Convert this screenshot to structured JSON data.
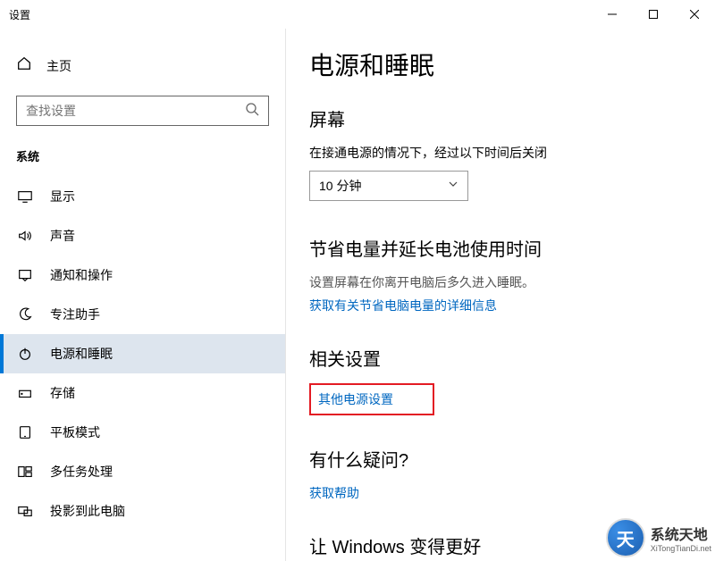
{
  "titlebar": {
    "title": "设置"
  },
  "sidebar": {
    "home": "主页",
    "search_placeholder": "查找设置",
    "category": "系统",
    "items": [
      {
        "label": "显示"
      },
      {
        "label": "声音"
      },
      {
        "label": "通知和操作"
      },
      {
        "label": "专注助手"
      },
      {
        "label": "电源和睡眠"
      },
      {
        "label": "存储"
      },
      {
        "label": "平板模式"
      },
      {
        "label": "多任务处理"
      },
      {
        "label": "投影到此电脑"
      }
    ]
  },
  "main": {
    "title": "电源和睡眠",
    "screen": {
      "heading": "屏幕",
      "desc": "在接通电源的情况下，经过以下时间后关闭",
      "dropdown_value": "10 分钟"
    },
    "battery": {
      "heading": "节省电量并延长电池使用时间",
      "desc": "设置屏幕在你离开电脑后多久进入睡眠。",
      "link": "获取有关节省电脑电量的详细信息"
    },
    "related": {
      "heading": "相关设置",
      "link": "其他电源设置"
    },
    "help": {
      "heading": "有什么疑问?",
      "link": "获取帮助"
    },
    "better": {
      "heading": "让 Windows 变得更好"
    }
  },
  "watermark": {
    "text": "系统天地",
    "url": "XiTongTianDi.net"
  }
}
